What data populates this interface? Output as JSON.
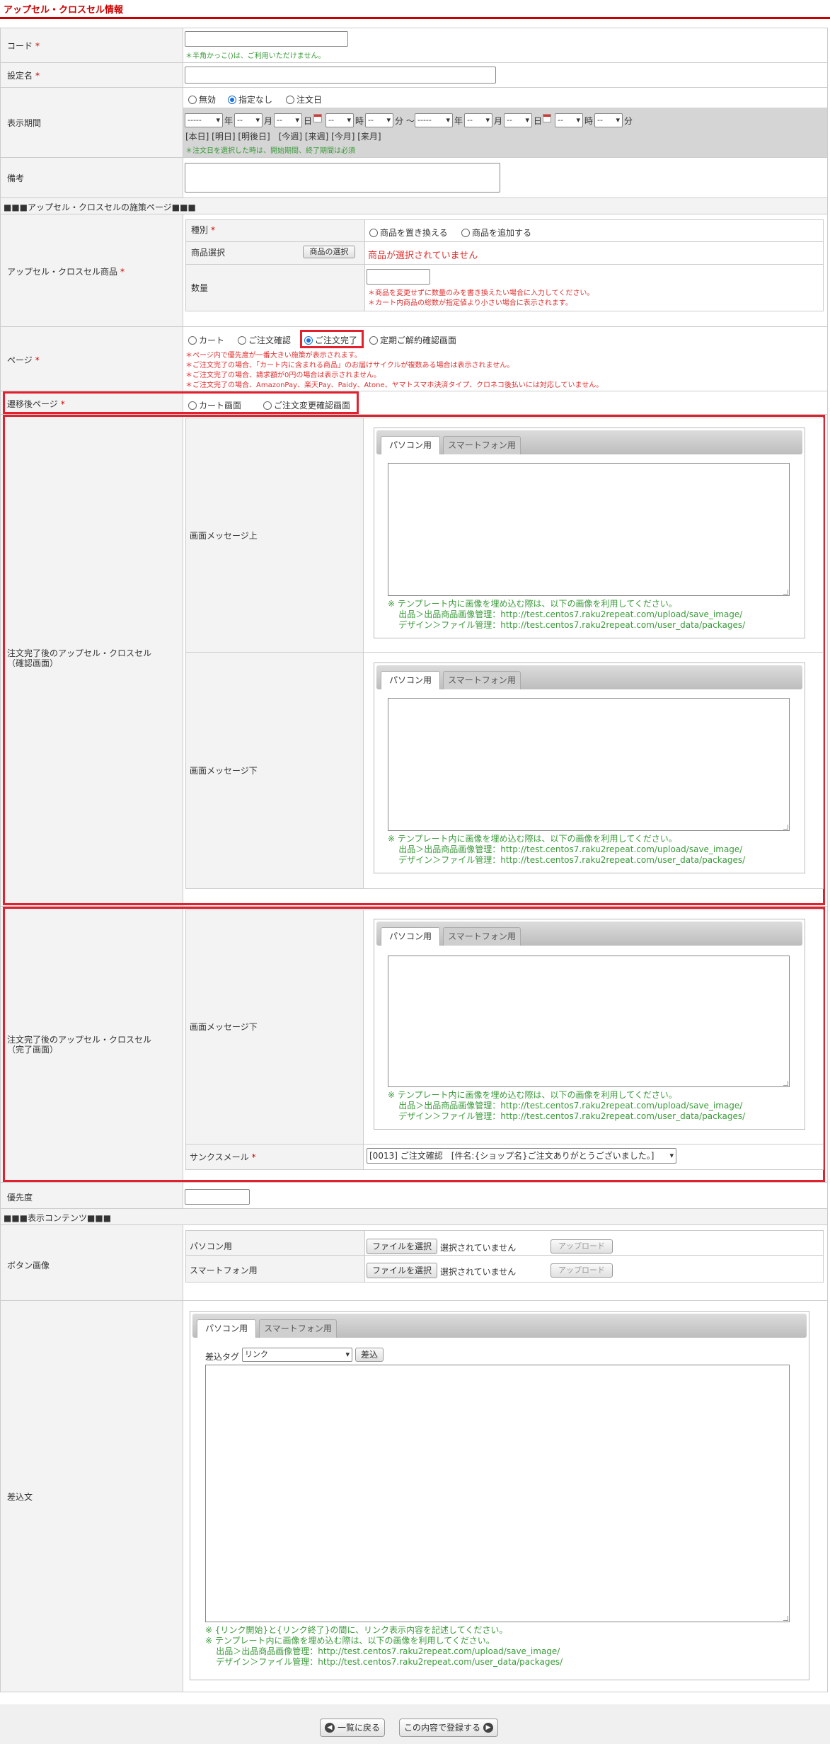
{
  "page": {
    "title": "アップセル・クロスセル情報"
  },
  "code": {
    "label": "コード",
    "required": "*",
    "note": "＊半角かっこ()は、ご利用いただけません。"
  },
  "setting_name": {
    "label": "設定名",
    "required": "*"
  },
  "display_period": {
    "label": "表示期間",
    "options": [
      "無効",
      "指定なし",
      "注文日"
    ],
    "selected": 1,
    "from": {
      "year": "-----",
      "month": "--",
      "day": "--",
      "hour": "--",
      "minute": "--"
    },
    "to": {
      "year": "-----",
      "month": "--",
      "day": "--",
      "hour": "--",
      "minute": "--"
    },
    "units": {
      "year": "年",
      "month": "月",
      "day": "日",
      "hour": "時",
      "minute": "分",
      "tilde": "～"
    },
    "quick_links": "[本日] [明日] [明後日]　[今週] [来週] [今月] [来月]",
    "note": "＊注文日を選択した時は、開始期間、終了期間は必須"
  },
  "remarks": {
    "label": "備考"
  },
  "section1": {
    "label": "■■■アップセル・クロスセルの施策ページ■■■"
  },
  "product": {
    "label": "アップセル・クロスセル商品",
    "required": "*",
    "type_label": "種別",
    "type_options": [
      "商品を置き換える",
      "商品を追加する"
    ],
    "select_label": "商品選択",
    "select_button": "商品の選択",
    "not_selected": "商品が選択されていません",
    "qty_label": "数量",
    "qty_notes": [
      "＊商品を変更せずに数量のみを書き換えたい場合に入力してください。",
      "＊カート内商品の総数が指定値より小さい場合に表示されます。"
    ]
  },
  "page_select": {
    "label": "ページ",
    "required": "*",
    "options": [
      "カート",
      "ご注文確認",
      "ご注文完了",
      "定期ご解約確認画面"
    ],
    "selected": 2,
    "notes": [
      "＊ページ内で優先度が一番大きい施策が表示されます。",
      "＊ご注文完了の場合、「カート内に含まれる商品」のお届けサイクルが複数ある場合は表示されません。",
      "＊ご注文完了の場合、請求額が0円の場合は表示されません。",
      "＊ご注文完了の場合、AmazonPay、楽天Pay、Paidy、Atone、ヤマトスマホ決済タイプ、クロネコ後払いには対応していません。"
    ]
  },
  "transition": {
    "label": "遷移後ページ",
    "required": "*",
    "options": [
      "カート画面",
      "ご注文変更確認画面"
    ]
  },
  "confirm_section": {
    "label1": "注文完了後のアップセル・クロスセル",
    "label2": "（確認画面）",
    "msg_top": "画面メッセージ上",
    "msg_bottom": "画面メッセージ下"
  },
  "complete_section": {
    "label1": "注文完了後のアップセル・クロスセル",
    "label2": "（完了画面）",
    "msg_bottom": "画面メッセージ下",
    "thanks_label": "サンクスメール",
    "thanks_value": "[0013] ご注文確認　[件名:{ショップ名}ご注文ありがとうございました。]"
  },
  "tabs": {
    "pc": "パソコン用",
    "sp": "スマートフォン用"
  },
  "template_note": {
    "line1": "※ テンプレート内に画像を埋め込む際は、以下の画像を利用してください。",
    "line2": "出品＞出品商品画像管理：http://test.centos7.raku2repeat.com/upload/save_image/",
    "line3": "デザイン＞ファイル管理：http://test.centos7.raku2repeat.com/user_data/packages/"
  },
  "priority": {
    "label": "優先度"
  },
  "section2": {
    "label": "■■■表示コンテンツ■■■"
  },
  "button_image": {
    "label": "ボタン画像",
    "pc_label": "パソコン用",
    "sp_label": "スマートフォン用",
    "file_button": "ファイルを選択",
    "no_file": "選択されていません",
    "upload": "アップロード"
  },
  "insert_text": {
    "label": "差込文",
    "tag_label": "差込タグ",
    "tag_value": "リンク",
    "insert_button": "差込",
    "note1": "※ {リンク開始}と{リンク終了}の間に、リンク表示内容を記述してください。"
  },
  "footer": {
    "back": "一覧に戻る",
    "submit": "この内容で登録する"
  }
}
